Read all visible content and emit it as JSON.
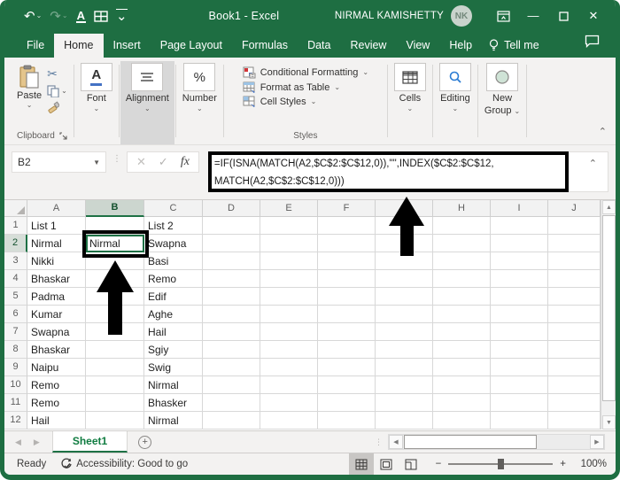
{
  "window": {
    "title": "Book1 - Excel",
    "user": "NIRMAL KAMISHETTY",
    "avatar_initials": "NK"
  },
  "tabs": [
    "File",
    "Home",
    "Insert",
    "Page Layout",
    "Formulas",
    "Data",
    "Review",
    "View",
    "Help"
  ],
  "tell_me_label": "Tell me",
  "ribbon": {
    "paste_label": "Paste",
    "clipboard_group_label": "Clipboard",
    "font_label": "Font",
    "alignment_label": "Alignment",
    "number_label": "Number",
    "number_glyph": "%",
    "font_glyph": "A",
    "conditional_formatting_label": "Conditional Formatting",
    "format_as_table_label": "Format as Table",
    "cell_styles_label": "Cell Styles",
    "styles_group_label": "Styles",
    "cells_label": "Cells",
    "editing_label": "Editing",
    "new_group_line1": "New",
    "new_group_line2": "Group"
  },
  "formula_bar": {
    "name_box": "B2",
    "fx_label": "fx",
    "cancel_glyph": "✕",
    "enter_glyph": "✓",
    "formula_line1": "=IF(ISNA(MATCH(A2,$C$2:$C$12,0)),\"\",INDEX($C$2:$C$12,",
    "formula_line2": "MATCH(A2,$C$2:$C$12,0)))"
  },
  "grid": {
    "columns": [
      "A",
      "B",
      "C",
      "D",
      "E",
      "F",
      "G",
      "H",
      "I",
      "J"
    ],
    "selected_column": "B",
    "selected_row": 2,
    "active_cell_col": "B",
    "active_cell_row": 2,
    "rows": [
      [
        "List 1",
        "",
        "List 2"
      ],
      [
        "Nirmal",
        "Nirmal",
        "Swapna"
      ],
      [
        "Nikki",
        "",
        "Basi"
      ],
      [
        "Bhaskar",
        "",
        "Remo"
      ],
      [
        "Padma",
        "",
        "Edif"
      ],
      [
        "Kumar",
        "",
        "Aghe"
      ],
      [
        "Swapna",
        "",
        "Hail"
      ],
      [
        "Bhaskar",
        "",
        "Sgiy"
      ],
      [
        "Naipu",
        "",
        "Swig"
      ],
      [
        "Remo",
        "",
        "Nirmal"
      ],
      [
        "Remo",
        "",
        "Bhasker"
      ],
      [
        "Hail",
        "",
        "Nirmal"
      ]
    ]
  },
  "sheet_bar": {
    "sheet_name": "Sheet1"
  },
  "status_bar": {
    "ready_label": "Ready",
    "accessibility_label": "Accessibility: Good to go",
    "zoom_level": "100%"
  },
  "colors": {
    "excel_green": "#1e6e42",
    "sheet_tab_green": "#107c41",
    "selection_green": "#1e7145",
    "annotation_black": "#000000"
  }
}
